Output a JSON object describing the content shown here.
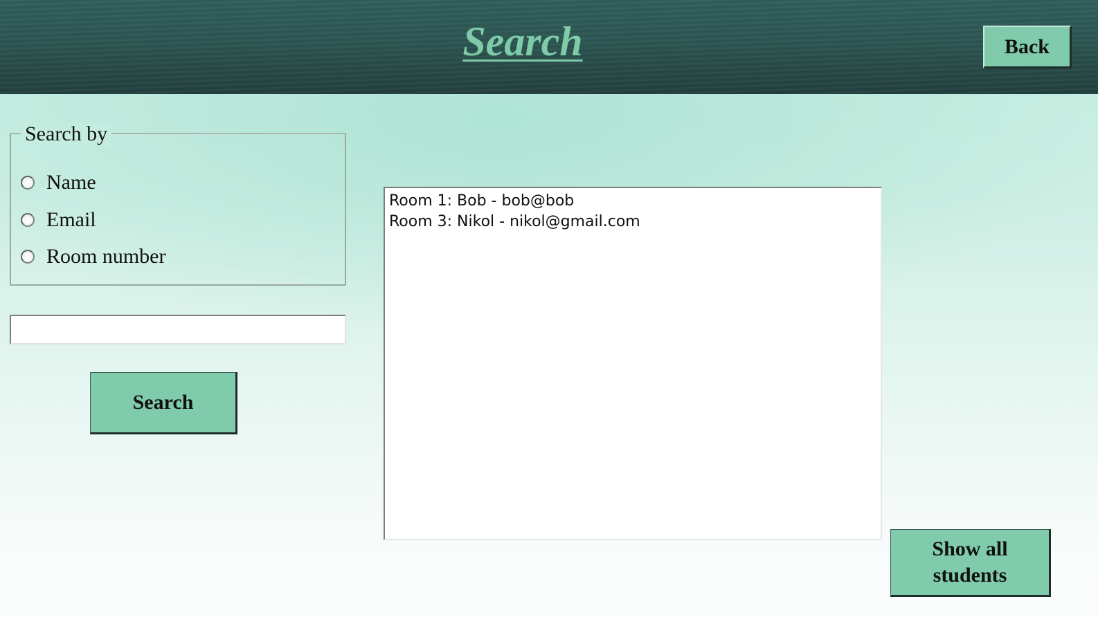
{
  "header": {
    "title": "Search",
    "back_label": "Back"
  },
  "search_by": {
    "legend": "Search by",
    "options": [
      {
        "label": "Name",
        "selected": false
      },
      {
        "label": "Email",
        "selected": false
      },
      {
        "label": "Room number",
        "selected": false
      }
    ]
  },
  "search_input": {
    "value": "",
    "placeholder": ""
  },
  "search_button_label": "Search",
  "results": {
    "items": [
      "Room 1: Bob - bob@bob",
      "Room 3: Nikol - nikol@gmail.com"
    ]
  },
  "show_all_button": {
    "line1": "Show all",
    "line2": "students"
  },
  "colors": {
    "header_bg": "#2c5551",
    "title_text": "#7ecaa9",
    "button_bg": "#80cbab",
    "page_bg": "#c3ece0"
  }
}
